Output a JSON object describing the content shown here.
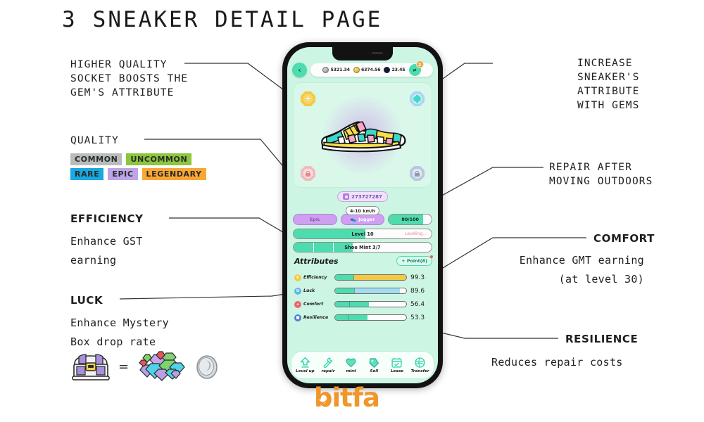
{
  "header": {
    "number": "3",
    "title": "SNEAKER DETAIL PAGE"
  },
  "annotations": {
    "socket": {
      "l1": "HIGHER QUALITY",
      "l2": "SOCKET BOOSTS THE",
      "l3": "GEM'S ATTRIBUTE"
    },
    "quality": {
      "title": "QUALITY"
    },
    "efficiency": {
      "title": "EFFICIENCY",
      "l1": "Enhance GST",
      "l2": "earning"
    },
    "luck": {
      "title": "LUCK",
      "l1": "Enhance Mystery",
      "l2": "Box drop rate",
      "equals": "="
    },
    "increase": {
      "l1": "INCREASE",
      "l2": "SNEAKER'S",
      "l3": "ATTRIBUTE",
      "l4": "WITH GEMS"
    },
    "repair": {
      "l1": "REPAIR AFTER",
      "l2": "MOVING OUTDOORS"
    },
    "comfort": {
      "title": "COMFORT",
      "l1": "Enhance GMT earning",
      "l2": "(at level 30)"
    },
    "resilience": {
      "title": "RESILIENCE",
      "l1": "Reduces repair costs"
    }
  },
  "quality_badges": [
    {
      "label": "COMMON",
      "color": "#b9bcbc"
    },
    {
      "label": "UNCOMMON",
      "color": "#8cc63e"
    },
    {
      "label": "RARE",
      "color": "#19a8e0"
    },
    {
      "label": "EPIC",
      "color": "#bda5e8"
    },
    {
      "label": "LEGENDARY",
      "color": "#f9a734"
    }
  ],
  "phone": {
    "back_icon": "‹",
    "wallet": {
      "currencies": [
        {
          "name": "gst",
          "value": "5321.34"
        },
        {
          "name": "gmt",
          "value": "6374.56"
        },
        {
          "name": "sol",
          "value": "23.45"
        }
      ],
      "add_glyph": "⟳",
      "badge_count": "2"
    },
    "sockets": [
      {
        "position": "top-left",
        "state": "empty-add",
        "symbol": "+",
        "quality_color": "#f5c842"
      },
      {
        "position": "top-right",
        "state": "filled-gem",
        "symbol": "",
        "quality_color": "#a8d8f0"
      },
      {
        "position": "bottom-left",
        "state": "locked",
        "symbol": "lock",
        "quality_color": "#f2b9bd"
      },
      {
        "position": "bottom-right",
        "state": "locked",
        "symbol": "lock",
        "quality_color": "#b9c7dd"
      }
    ],
    "shoe_id": "273727287",
    "speed_tag": "4-10 km/h",
    "pills": {
      "quality": "Epic",
      "type": "Jogger",
      "durability": "80/100",
      "durability_percent": 80
    },
    "bars": {
      "level": {
        "label": "Level 10",
        "status": "Leveling...",
        "percent": 52
      },
      "mint": {
        "label": "Shoe Mint 3/7",
        "percent": 43,
        "segments": 7,
        "filled": 3
      }
    },
    "attributes_section": {
      "title": "Attributes",
      "point_button": "+ Point(8)"
    },
    "attributes": [
      {
        "name": "Efficiency",
        "value": "99.3",
        "base_percent": 26,
        "bonus_percent": 74,
        "bonus_color": "#f5c842",
        "icon_letter": "E",
        "icon_color": "#f5c842"
      },
      {
        "name": "Luck",
        "value": "89.6",
        "base_percent": 27,
        "bonus_percent": 64,
        "bonus_color": "#a3dcf5",
        "icon_letter": "U",
        "icon_color": "#5fb8e8"
      },
      {
        "name": "Comfort",
        "value": "56.4",
        "base_percent": 48,
        "bonus_percent": 0,
        "bonus_color": "",
        "icon_letter": "+",
        "icon_color": "#f0626e"
      },
      {
        "name": "Resilience",
        "value": "53.3",
        "base_percent": 46,
        "bonus_percent": 0,
        "bonus_color": "",
        "icon_letter": "■",
        "icon_color": "#4a7fd4"
      }
    ],
    "toolbar": [
      {
        "label": "Level up",
        "icon": "up-arrow-icon"
      },
      {
        "label": "repair",
        "icon": "wrench-icon"
      },
      {
        "label": "mint",
        "icon": "heart-icon"
      },
      {
        "label": "Sell",
        "icon": "tag-icon"
      },
      {
        "label": "Lease",
        "icon": "calendar-icon"
      },
      {
        "label": "Transfer",
        "icon": "globe-icon"
      }
    ]
  },
  "footer": {
    "logo_text": "bitfa",
    "logo_color": "#f0962a"
  }
}
